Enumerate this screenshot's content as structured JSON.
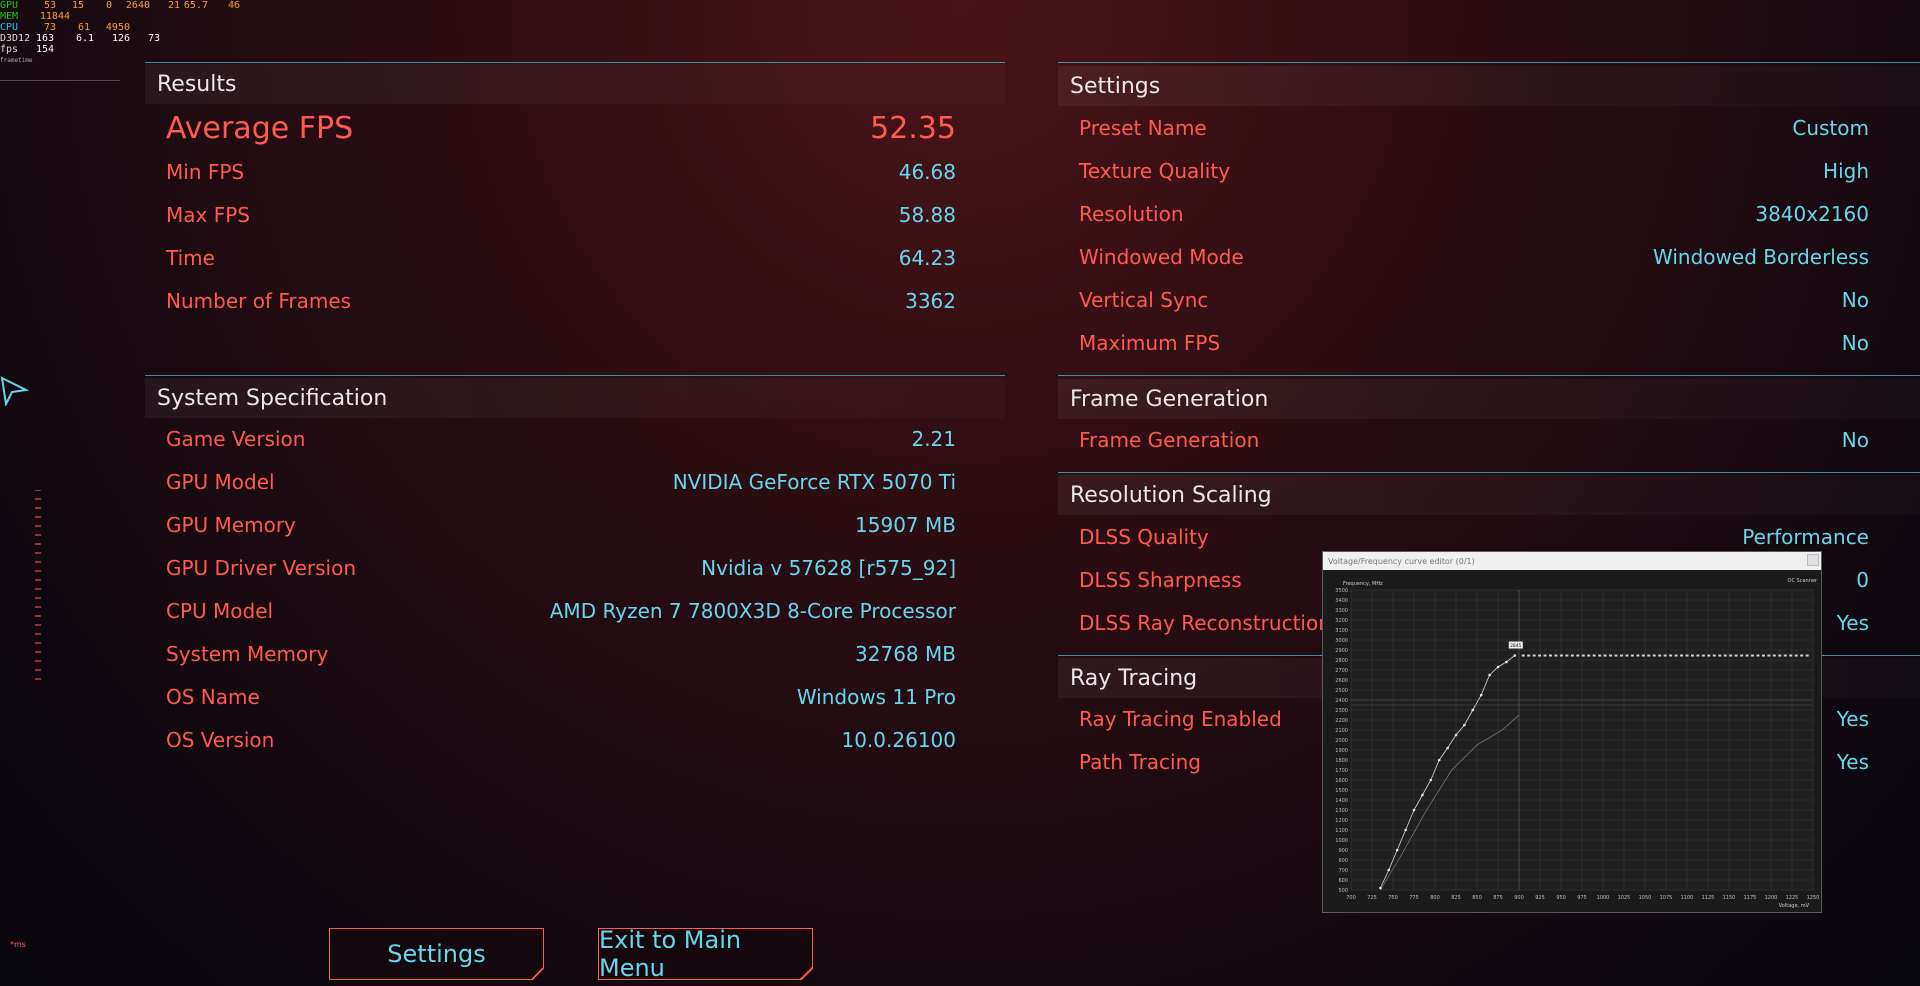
{
  "osd": {
    "rows": [
      {
        "label": "GPU",
        "vals": [
          "53",
          "15",
          "0",
          "2640",
          "21",
          "65.7",
          "46"
        ]
      },
      {
        "label": "MEM",
        "vals": [
          "11844"
        ]
      },
      {
        "label": "CPU",
        "vals": [
          "73",
          "61",
          "4950"
        ]
      },
      {
        "label": "D3D12",
        "vals": [
          "163",
          "6.1",
          "126",
          "73"
        ]
      },
      {
        "label": "fps",
        "vals": [
          "154"
        ]
      }
    ]
  },
  "results": {
    "header": "Results",
    "average_label": "Average FPS",
    "average_value": "52.35",
    "rows": [
      {
        "k": "Min FPS",
        "v": "46.68"
      },
      {
        "k": "Max FPS",
        "v": "58.88"
      },
      {
        "k": "Time",
        "v": "64.23"
      },
      {
        "k": "Number of Frames",
        "v": "3362"
      }
    ]
  },
  "system": {
    "header": "System Specification",
    "rows": [
      {
        "k": "Game Version",
        "v": "2.21"
      },
      {
        "k": "GPU Model",
        "v": "NVIDIA GeForce RTX 5070 Ti"
      },
      {
        "k": "GPU Memory",
        "v": "15907 MB"
      },
      {
        "k": "GPU Driver Version",
        "v": "Nvidia v 57628 [r575_92]"
      },
      {
        "k": "CPU Model",
        "v": "AMD Ryzen 7 7800X3D 8-Core Processor"
      },
      {
        "k": "System Memory",
        "v": "32768 MB"
      },
      {
        "k": "OS Name",
        "v": "Windows 11 Pro"
      },
      {
        "k": "OS Version",
        "v": "10.0.26100"
      }
    ]
  },
  "settings": {
    "header": "Settings",
    "rows": [
      {
        "k": "Preset Name",
        "v": "Custom"
      },
      {
        "k": "Texture Quality",
        "v": "High"
      },
      {
        "k": "Resolution",
        "v": "3840x2160"
      },
      {
        "k": "Windowed Mode",
        "v": "Windowed Borderless"
      },
      {
        "k": "Vertical Sync",
        "v": "No"
      },
      {
        "k": "Maximum FPS",
        "v": "No"
      }
    ]
  },
  "frame_generation": {
    "header": "Frame Generation",
    "rows": [
      {
        "k": "Frame Generation",
        "v": "No"
      }
    ]
  },
  "resolution_scaling": {
    "header": "Resolution Scaling",
    "rows": [
      {
        "k": "DLSS Quality",
        "v": "Performance"
      },
      {
        "k": "DLSS Sharpness",
        "v": "0"
      },
      {
        "k": "DLSS Ray Reconstruction E",
        "v": "Yes"
      }
    ]
  },
  "ray_tracing": {
    "header": "Ray Tracing",
    "rows": [
      {
        "k": "Ray Tracing Enabled",
        "v": "Yes"
      },
      {
        "k": "Path Tracing",
        "v": "Yes"
      }
    ]
  },
  "buttons": {
    "settings": "Settings",
    "exit": "Exit to Main Menu"
  },
  "vf_editor": {
    "title": "Voltage/Frequency curve editor (0/1)",
    "scanner": "OC Scanner",
    "ylabel": "Frequency, MHz",
    "xlabel": "Voltage, mV",
    "y_ticks": [
      "3500",
      "3400",
      "3300",
      "3200",
      "3100",
      "3000",
      "2900",
      "2800",
      "2700",
      "2600",
      "2500",
      "2400",
      "2300",
      "2200",
      "2100",
      "2000",
      "1900",
      "1800",
      "1700",
      "1600",
      "1500",
      "1400",
      "1300",
      "1200",
      "1100",
      "1000",
      "900",
      "800",
      "700",
      "600",
      "500"
    ],
    "x_ticks": [
      "700",
      "725",
      "750",
      "775",
      "800",
      "825",
      "850",
      "875",
      "900",
      "925",
      "950",
      "975",
      "1000",
      "1025",
      "1050",
      "1075",
      "1100",
      "1125",
      "1150",
      "1175",
      "1200",
      "1225",
      "1250"
    ],
    "marker_label": "2845"
  }
}
